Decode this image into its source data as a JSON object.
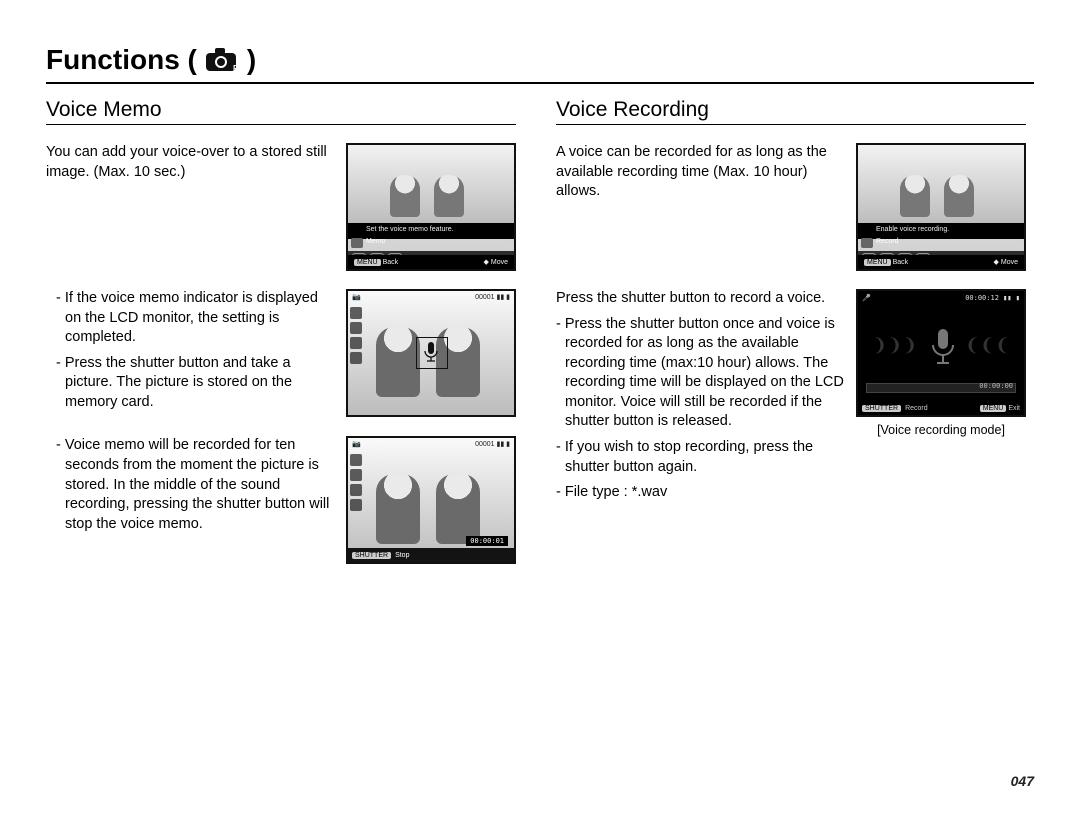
{
  "page": {
    "title": "Functions (",
    "title_close": ")",
    "number": "047"
  },
  "left": {
    "heading": "Voice Memo",
    "intro": "You can add your voice-over to a stored still image. (Max. 10 sec.)",
    "screen1": {
      "banner": "Set the voice memo feature.",
      "label": "Memo",
      "back": "Back",
      "move": "Move",
      "menu": "MENU"
    },
    "para2a": "- If the voice memo indicator is displayed on the LCD monitor, the setting is completed.",
    "para2b": "- Press the shutter button and take a picture. The picture is stored on the memory card.",
    "screen2": {
      "counter": "00001"
    },
    "para3": "- Voice memo will be recorded for ten seconds from the moment the picture is stored. In the middle of the sound recording, pressing the shutter button will stop the voice memo.",
    "screen3": {
      "counter": "00001",
      "timer": "00:00:01",
      "shutter": "SHUTTER",
      "stop": "Stop"
    }
  },
  "right": {
    "heading": "Voice Recording",
    "intro": "A voice can be recorded for as long as the available recording time (Max. 10 hour) allows.",
    "screen1": {
      "banner": "Enable voice recording.",
      "label": "Record",
      "back": "Back",
      "move": "Move",
      "menu": "MENU"
    },
    "para2_lead": "Press the shutter button to record a voice.",
    "para2a": "- Press the shutter button once and voice is recorded for as long as the available recording time (max:10 hour) allows. The recording time will be displayed on the LCD monitor. Voice will still be recorded if the shutter button is released.",
    "para2b": "- If you wish to stop recording, press the shutter button again.",
    "para2c": "- File type : *.wav",
    "screen2": {
      "elapsed": "00:00:12",
      "bar_time": "00:00:00",
      "shutter": "SHUTTER",
      "record": "Record",
      "menu": "MENU",
      "exit": "Exit",
      "caption": "[Voice recording mode]"
    }
  }
}
